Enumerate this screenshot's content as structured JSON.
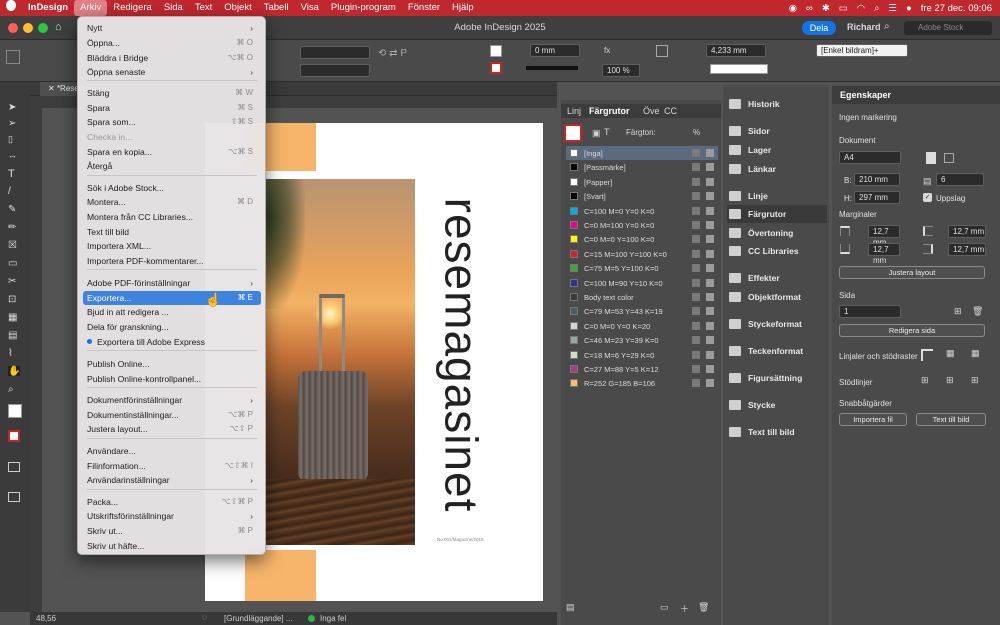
{
  "menubar": {
    "app_name": "InDesign",
    "items": [
      "Arkiv",
      "Redigera",
      "Sida",
      "Text",
      "Objekt",
      "Tabell",
      "Visa",
      "Plugin-program",
      "Fönster",
      "Hjälp"
    ],
    "clock": "fre 27 dec. 09:06"
  },
  "titlebar": {
    "title": "Adobe InDesign 2025",
    "share_button": "Dela",
    "user": "Richard",
    "search_placeholder": "Adobe Stock"
  },
  "control_panel": {
    "stroke_weight": "0 mm",
    "opacity": "100 %",
    "dimension": "4,233 mm",
    "object_style": "[Enkel bildram]+"
  },
  "document": {
    "tab_label": "*Resema",
    "title_text": "resemagasinet",
    "issue_text": "No.001/Magazine/2016"
  },
  "status": {
    "zoom": "48,56",
    "style": "[Grundläggande] ...",
    "preflight": "Inga fel"
  },
  "swatches": {
    "tabs": [
      "Linj",
      "Färgrutor",
      "Öve",
      "CC"
    ],
    "tint_label": "Färgton:",
    "tint_unit": "%",
    "items": [
      {
        "name": "[Inga]",
        "color": "#ffffff",
        "selected": true
      },
      {
        "name": "[Passmärke]",
        "color": "#000000"
      },
      {
        "name": "[Papper]",
        "color": "#ffffff"
      },
      {
        "name": "[Svart]",
        "color": "#000000"
      },
      {
        "name": "C=100 M=0 Y=0 K=0",
        "color": "#00aeef"
      },
      {
        "name": "C=0 M=100 Y=0 K=0",
        "color": "#ec008c"
      },
      {
        "name": "C=0 M=0 Y=100 K=0",
        "color": "#fff200"
      },
      {
        "name": "C=15 M=100 Y=100 K=0",
        "color": "#d2232a"
      },
      {
        "name": "C=75 M=5 Y=100 K=0",
        "color": "#3aaa35"
      },
      {
        "name": "C=100 M=90 Y=10 K=0",
        "color": "#2e3192"
      },
      {
        "name": "Body text color",
        "color": "#3b3b3b"
      },
      {
        "name": "C=79 M=53 Y=43 K=19",
        "color": "#3f5f6c"
      },
      {
        "name": "C=0 M=0 Y=0 K=20",
        "color": "#d1d3d4"
      },
      {
        "name": "C=46 M=23 Y=39 K=0",
        "color": "#93ab9e"
      },
      {
        "name": "C=18 M=6 Y=29 K=0",
        "color": "#d6dfc0"
      },
      {
        "name": "C=27 M=88 Y=5 K=12",
        "color": "#a73a8c"
      },
      {
        "name": "R=252 G=185 B=106",
        "color": "#fcb96a"
      }
    ]
  },
  "panel_list": [
    "Historik",
    "Sidor",
    "Lager",
    "Länkar",
    "Linje",
    "Färgrutor",
    "Övertoning",
    "CC Libraries",
    "Effekter",
    "Objektformat",
    "Styckeformat",
    "Teckenformat",
    "Figursättning",
    "Stycke",
    "Text till bild"
  ],
  "properties": {
    "tab": "Egenskaper",
    "selection": "Ingen markering",
    "document_header": "Dokument",
    "page_size": "A4",
    "width_label": "B:",
    "width": "210 mm",
    "height_label": "H:",
    "height": "297 mm",
    "pages": "6",
    "facing_pages": "Uppslag",
    "margins_header": "Marginaler",
    "margin_top": "12,7 mm",
    "margin_bottom": "12,7 mm",
    "margin_inside": "12,7 mm",
    "margin_outside": "12,7 mm",
    "adjust_layout": "Justera layout",
    "page_header": "Sida",
    "page_number": "1",
    "edit_page": "Redigera sida",
    "rulers_header": "Linjaler och stödraster",
    "guides_header": "Stödlinjer",
    "quick_actions_header": "Snabbåtgärder",
    "import_file": "Importera fil",
    "text_to_image": "Text till bild"
  },
  "file_menu": {
    "items": [
      {
        "label": "Nytt",
        "shortcut": "",
        "arrow": true
      },
      {
        "label": "Öppna...",
        "shortcut": "⌘ O"
      },
      {
        "label": "Bläddra i Bridge",
        "shortcut": "⌥⌘ O"
      },
      {
        "label": "Öppna senaste",
        "shortcut": "",
        "arrow": true
      },
      {
        "label": "Stäng",
        "shortcut": "⌘ W"
      },
      {
        "label": "Spara",
        "shortcut": "⌘ S"
      },
      {
        "label": "Spara som...",
        "shortcut": "⇧⌘ S"
      },
      {
        "label": "Checka in...",
        "shortcut": "",
        "disabled": true
      },
      {
        "label": "Spara en kopia...",
        "shortcut": "⌥⌘ S"
      },
      {
        "label": "Återgå",
        "shortcut": ""
      },
      {
        "label": "Sök i Adobe Stock...",
        "shortcut": ""
      },
      {
        "label": "Montera...",
        "shortcut": "⌘ D"
      },
      {
        "label": "Montera från CC Libraries...",
        "shortcut": ""
      },
      {
        "label": "Text till bild",
        "shortcut": ""
      },
      {
        "label": "Importera XML...",
        "shortcut": ""
      },
      {
        "label": "Importera PDF-kommentarer...",
        "shortcut": ""
      },
      {
        "label": "Adobe PDF-förinställningar",
        "shortcut": "",
        "arrow": true
      },
      {
        "label": "Exportera...",
        "shortcut": "⌘ E",
        "highlighted": true
      },
      {
        "label": "Bjud in att redigera ...",
        "shortcut": ""
      },
      {
        "label": "Dela för granskning...",
        "shortcut": ""
      },
      {
        "label": "Exportera till Adobe Express",
        "shortcut": "",
        "dot": true
      },
      {
        "label": "Publish Online...",
        "shortcut": ""
      },
      {
        "label": "Publish Online-kontrollpanel...",
        "shortcut": ""
      },
      {
        "label": "Dokumentförinställningar",
        "shortcut": "",
        "arrow": true
      },
      {
        "label": "Dokumentinställningar...",
        "shortcut": "⌥⌘ P"
      },
      {
        "label": "Justera layout...",
        "shortcut": "⌥⇧ P"
      },
      {
        "label": "Användare...",
        "shortcut": ""
      },
      {
        "label": "Filinformation...",
        "shortcut": "⌥⇧⌘ I"
      },
      {
        "label": "Användarinställningar",
        "shortcut": "",
        "arrow": true
      },
      {
        "label": "Packa...",
        "shortcut": "⌥⇧⌘ P"
      },
      {
        "label": "Utskriftsförinställningar",
        "shortcut": "",
        "arrow": true
      },
      {
        "label": "Skriv ut...",
        "shortcut": "⌘ P"
      },
      {
        "label": "Skriv ut häfte...",
        "shortcut": ""
      }
    ]
  },
  "colors": {
    "menubar": "#c0282e",
    "accent": "#1473e6",
    "menu_highlight": "#3e83dd",
    "orange_block": "#f6b56a"
  }
}
